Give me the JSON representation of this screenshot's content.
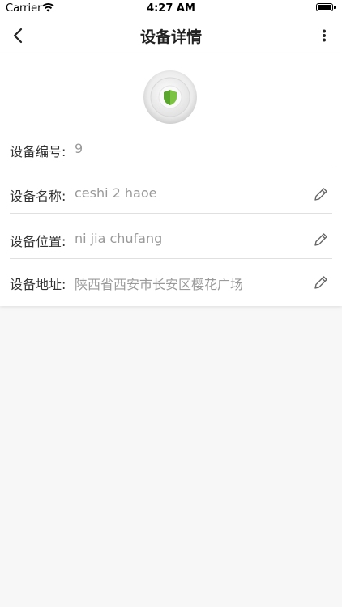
{
  "status_bar": {
    "carrier": "Carrier",
    "time": "4:27 AM"
  },
  "nav": {
    "title": "设备详情",
    "back_icon": "chevron-left-icon",
    "more_icon": "more-vertical-icon"
  },
  "device": {
    "icon": "shield-device-icon",
    "accent_color": "#7cc243",
    "fields": [
      {
        "label": "设备编号:",
        "value": "9",
        "editable": false
      },
      {
        "label": "设备名称:",
        "value": "ceshi 2 haoe",
        "editable": true
      },
      {
        "label": "设备位置:",
        "value": "ni jia chufang",
        "editable": true
      },
      {
        "label": "设备地址:",
        "value": "陕西省西安市长安区樱花广场",
        "editable": true
      }
    ]
  }
}
